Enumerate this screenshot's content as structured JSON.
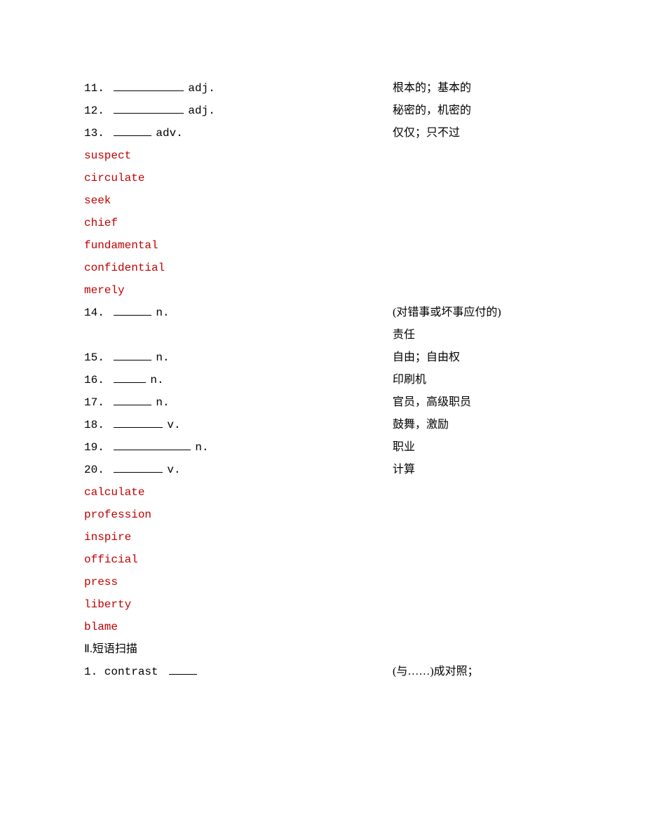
{
  "items_top": [
    {
      "num": "11",
      "pos": "adj.",
      "blank": "u-long",
      "def": "根本的；基本的"
    },
    {
      "num": "12",
      "pos": "adj.",
      "blank": "u-long",
      "def": "秘密的，机密的"
    },
    {
      "num": "13",
      "pos": "adv.",
      "blank": "u-short",
      "def": "仅仅；只不过"
    }
  ],
  "answers_top": [
    "suspect",
    "circulate",
    "seek",
    "chief",
    "fundamental",
    "confidential",
    "merely"
  ],
  "items_mid": [
    {
      "num": "14",
      "pos": "n.",
      "blank": "u-short",
      "def": "(对错事或坏事应付的)",
      "def2": "责任"
    },
    {
      "num": "15",
      "pos": "n.",
      "blank": "u-short",
      "def": "自由；自由权"
    },
    {
      "num": "16",
      "pos": "n.",
      "blank": "u-xs",
      "def": "印刷机"
    },
    {
      "num": "17",
      "pos": "n.",
      "blank": "u-short",
      "def": "官员，高级职员"
    },
    {
      "num": "18",
      "pos": "v.",
      "blank": "u-med",
      "def": "鼓舞，激励"
    },
    {
      "num": "19",
      "pos": "n.",
      "blank": "u-xlong",
      "def": "职业"
    },
    {
      "num": "20",
      "pos": "v.",
      "blank": "u-med",
      "def": "计算"
    }
  ],
  "answers_mid": [
    "calculate",
    "profession",
    "inspire",
    "official",
    "press",
    "liberty",
    "blame"
  ],
  "section2": "Ⅱ.短语扫描",
  "phrase1_left": "1. contrast ",
  "phrase1_right": "(与……)成对照；"
}
